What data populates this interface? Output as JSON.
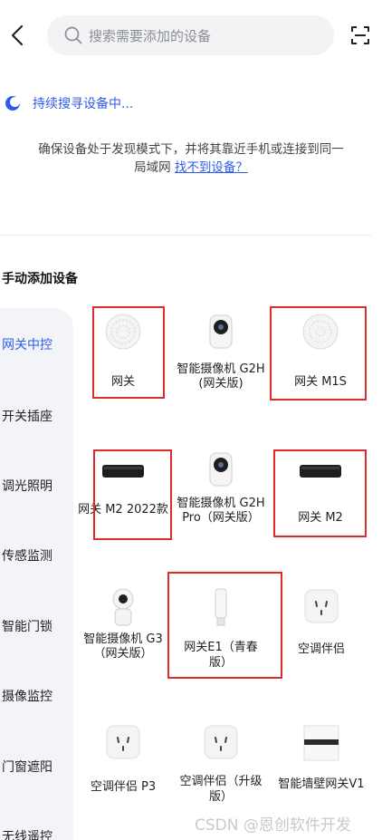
{
  "header": {
    "search_placeholder": "搜索需要添加的设备"
  },
  "status": {
    "searching_text": "持续搜寻设备中..."
  },
  "hint": {
    "line1": "确保设备处于发现模式下，并将其靠近手机或连接到同一",
    "line2_prefix": "局域网 ",
    "help_link": "找不到设备？"
  },
  "section": {
    "title": "手动添加设备"
  },
  "sidebar": {
    "items": [
      {
        "label": "网关中控",
        "active": true
      },
      {
        "label": "开关插座"
      },
      {
        "label": "调光照明"
      },
      {
        "label": "传感监测"
      },
      {
        "label": "智能门锁"
      },
      {
        "label": "摄像监控"
      },
      {
        "label": "门窗遮阳"
      },
      {
        "label": "无线遥控"
      }
    ]
  },
  "devices": [
    {
      "name": "网关",
      "icon": "gateway-round-icon"
    },
    {
      "name": "智能摄像机 G2H (网关版)",
      "icon": "camera-g2h-icon"
    },
    {
      "name": "网关 M1S",
      "icon": "gateway-m1s-icon"
    },
    {
      "name": "网关 M2 2022款",
      "icon": "gateway-box-icon"
    },
    {
      "name": "智能摄像机 G2H Pro（网关版）",
      "icon": "camera-g2h-pro-icon"
    },
    {
      "name": "网关 M2",
      "icon": "gateway-box-icon"
    },
    {
      "name": "智能摄像机 G3（网关版）",
      "icon": "camera-g3-icon"
    },
    {
      "name": "网关E1（青春版）",
      "icon": "usb-dongle-icon"
    },
    {
      "name": "空调伴侣",
      "icon": "ac-plug-icon"
    },
    {
      "name": "空调伴侣 P3",
      "icon": "ac-plug-icon"
    },
    {
      "name": "空调伴侣（升级版）",
      "icon": "ac-plug-icon"
    },
    {
      "name": "智能墙壁网关V1",
      "icon": "wall-gateway-icon"
    }
  ],
  "highlight_color": "#e02b2b",
  "accent_color": "#2f5bea",
  "watermark": "CSDN @恩创软件开发"
}
